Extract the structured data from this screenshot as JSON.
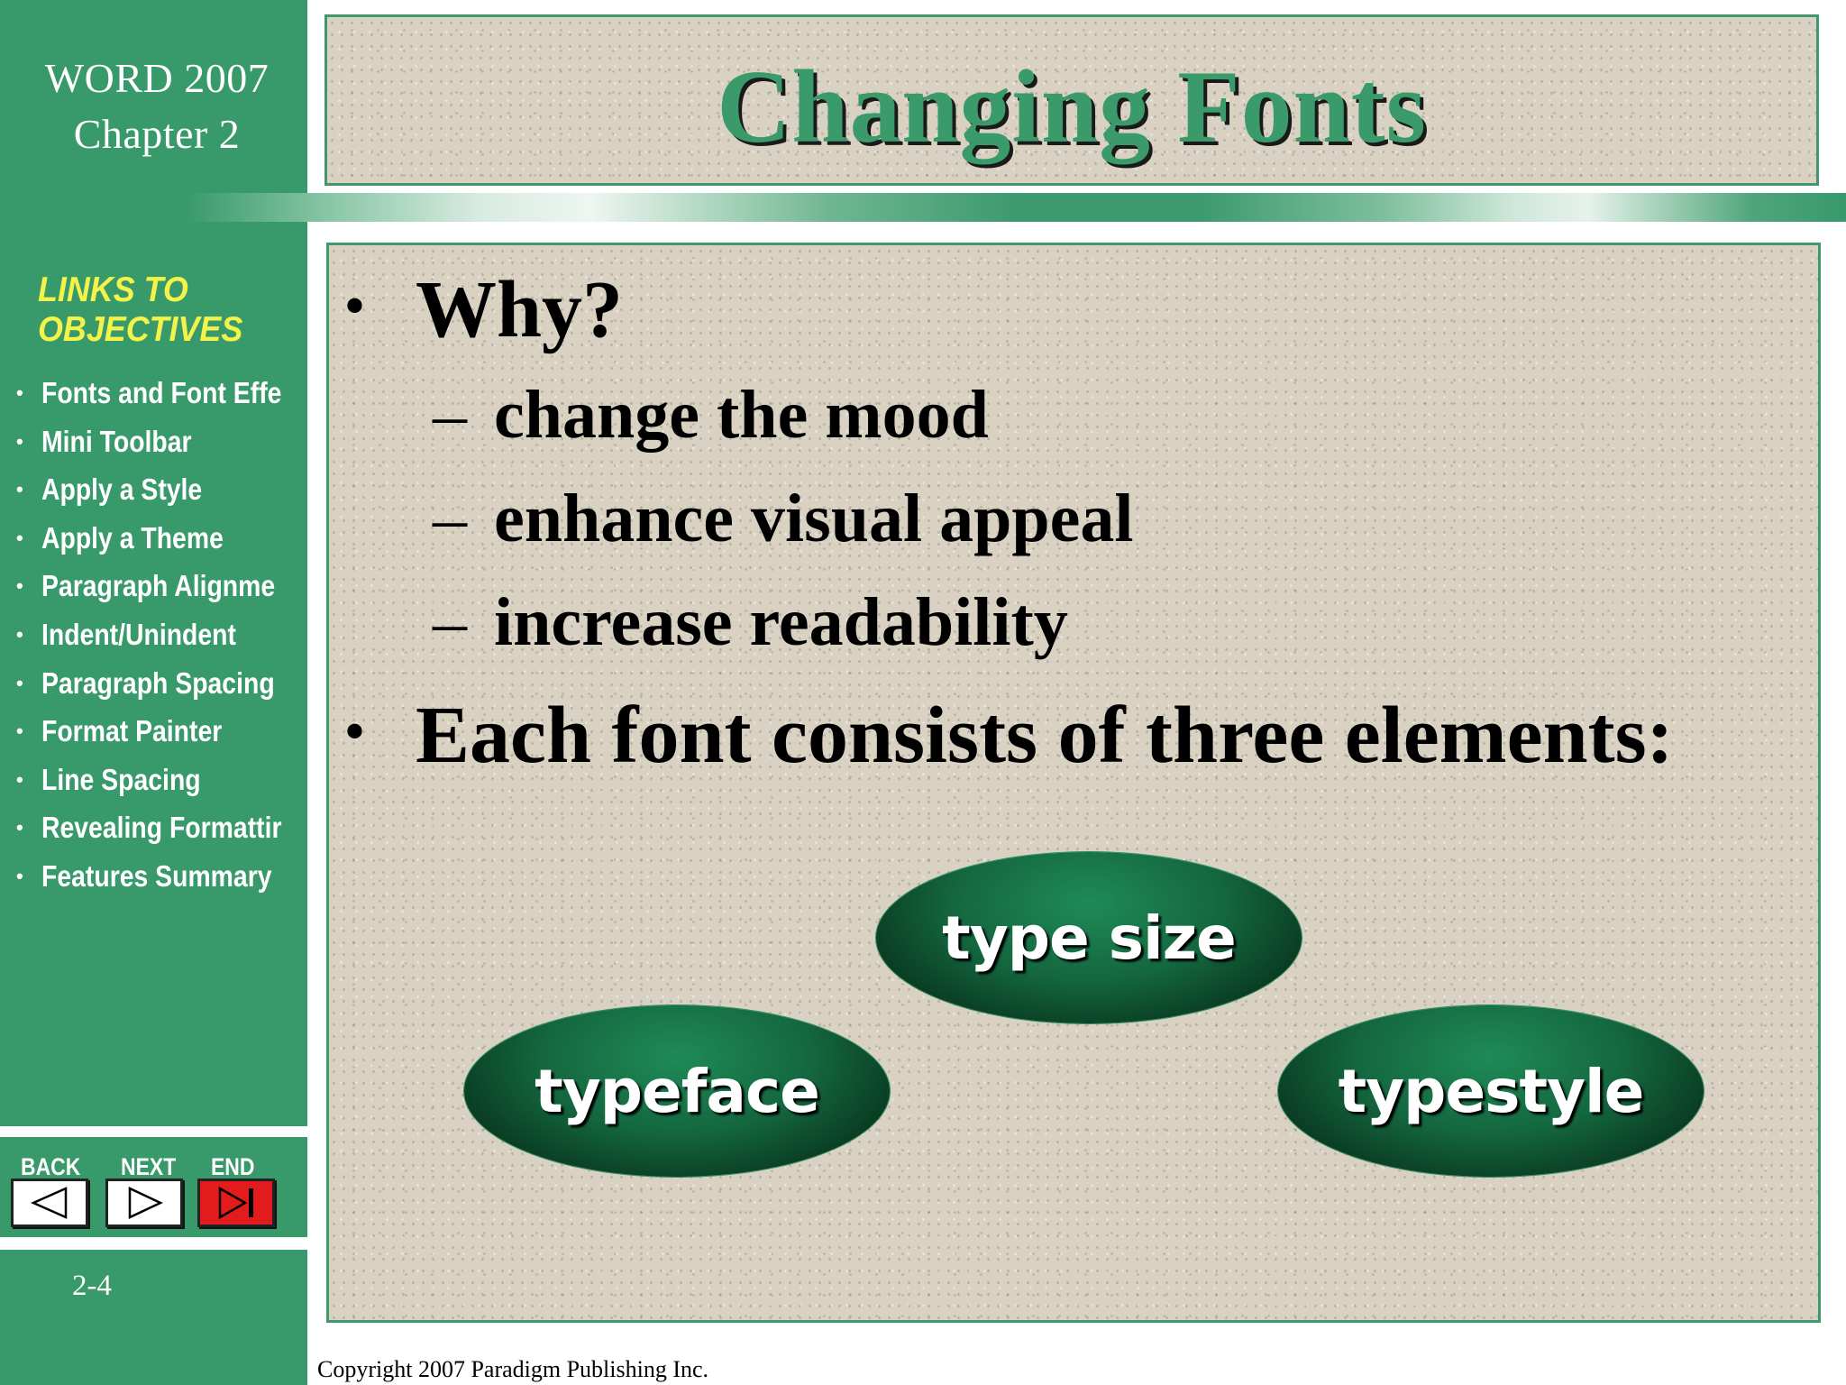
{
  "sidebar": {
    "app_title": "WORD 2007",
    "chapter": "Chapter 2",
    "links_heading_line1": "LINKS TO",
    "links_heading_line2": "OBJECTIVES",
    "objectives": [
      "Fonts and Font Effe",
      "Mini Toolbar",
      "Apply  a Style",
      "Apply a Theme",
      "Paragraph Alignme",
      "Indent/Unindent",
      "Paragraph Spacing",
      "Format Painter",
      "Line Spacing",
      "Revealing Formattir",
      "Features Summary"
    ],
    "nav": {
      "back_label": "BACK",
      "next_label": "NEXT",
      "end_label": "END"
    },
    "page_number": "2-4"
  },
  "slide": {
    "title": "Changing Fonts",
    "bullet1": "Why?",
    "sub_bullets": [
      "change the mood",
      "enhance visual appeal",
      "increase readability"
    ],
    "bullet2": "Each font consists of three elements:",
    "elements": {
      "top": "type size",
      "left": "typeface",
      "right": "typestyle"
    }
  },
  "footer": {
    "copyright": "Copyright 2007 Paradigm Publishing Inc."
  },
  "colors": {
    "sidebar_green": "#38996b",
    "heading_yellow": "#f3f34a",
    "title_green": "#3a9a6a",
    "end_button_red": "#e21c1c",
    "ellipse_dark_green": "#14673f"
  },
  "icons": {
    "back": "triangle-left-icon",
    "next": "triangle-right-icon",
    "end": "skip-to-end-icon"
  }
}
